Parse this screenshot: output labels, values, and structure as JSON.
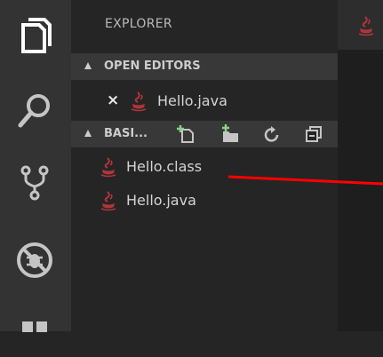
{
  "activity_bar": {
    "icons": [
      "files-icon",
      "search-icon",
      "source-control-icon",
      "debug-icon",
      "extensions-icon"
    ]
  },
  "sidebar": {
    "title": "EXPLORER",
    "open_editors": {
      "label": "OPEN EDITORS",
      "items": [
        {
          "close": "×",
          "name": "Hello.java"
        }
      ]
    },
    "folder": {
      "label": "BASI...",
      "toolbar": [
        "new-file-icon",
        "new-folder-icon",
        "refresh-icon",
        "collapse-all-icon"
      ],
      "files": [
        {
          "name": "Hello.class"
        },
        {
          "name": "Hello.java"
        }
      ]
    }
  },
  "colors": {
    "activity_bar": "#333333",
    "sidebar": "#252526",
    "section_header": "#383838",
    "editor": "#1e1e1e",
    "java_icon": "#b0353a",
    "accent_green": "#89d185",
    "annotation": "#ff0000"
  }
}
